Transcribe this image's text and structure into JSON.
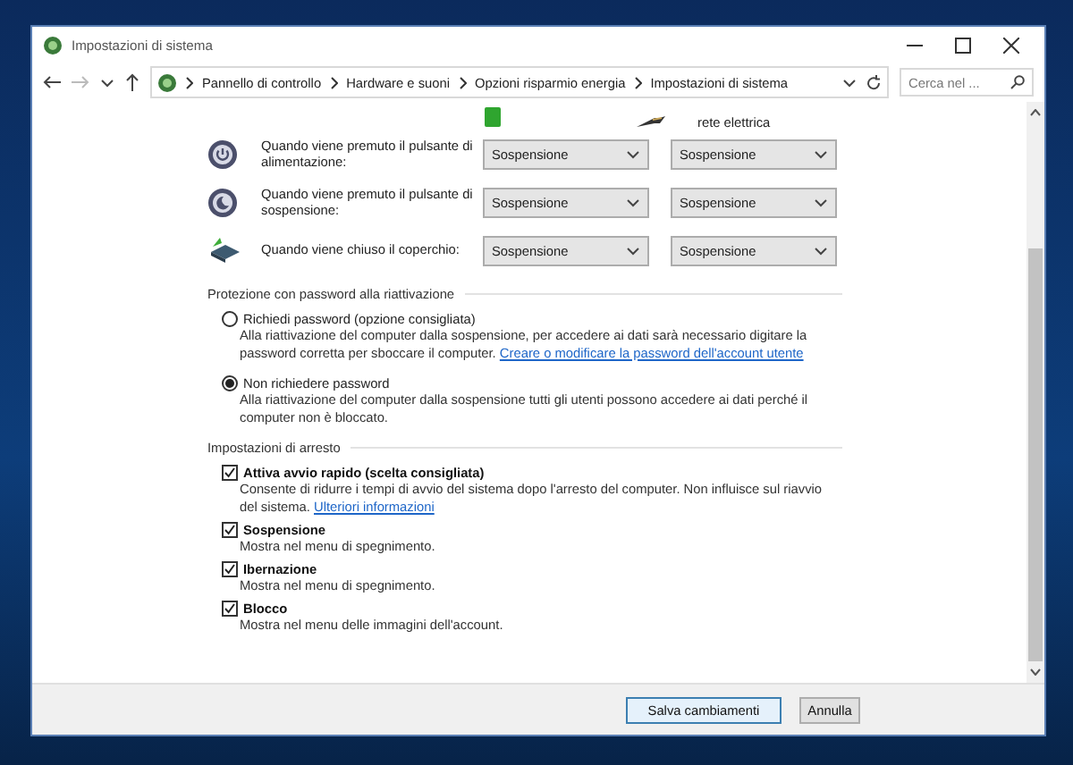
{
  "window": {
    "title": "Impostazioni di sistema"
  },
  "address_bar": {
    "path": [
      "Pannello di controllo",
      "Hardware e suoni",
      "Opzioni risparmio energia",
      "Impostazioni di sistema"
    ],
    "search_placeholder": "Cerca nel ..."
  },
  "power_settings": {
    "column_2_header": "rete elettrica",
    "rows": [
      {
        "kind": "power",
        "label": "Quando viene premuto il pulsante di alimentazione:",
        "on_battery": "Sospensione",
        "plugged_in": "Sospensione"
      },
      {
        "kind": "sleep",
        "label": "Quando viene premuto il pulsante di sospensione:",
        "on_battery": "Sospensione",
        "plugged_in": "Sospensione"
      },
      {
        "kind": "lid",
        "label": "Quando viene chiuso il coperchio:",
        "on_battery": "Sospensione",
        "plugged_in": "Sospensione"
      }
    ]
  },
  "password_section": {
    "title": "Protezione con password alla riattivazione",
    "options": [
      {
        "label": "Richiedi password (opzione consigliata)",
        "description": "Alla riattivazione del computer dalla sospensione, per accedere ai dati sarà necessario digitare la password corretta per sboccare il computer.",
        "link": "Creare o modificare la password dell'account utente",
        "selected": false
      },
      {
        "label": "Non richiedere password",
        "description": "Alla riattivazione del computer dalla sospensione tutti gli utenti possono accedere ai dati perché il computer non è bloccato.",
        "selected": true
      }
    ]
  },
  "shutdown_section": {
    "title": "Impostazioni di arresto",
    "options": [
      {
        "label": "Attiva avvio rapido (scelta consigliata)",
        "description": "Consente di ridurre i tempi di avvio del sistema dopo l'arresto del computer. Non influisce sul riavvio del sistema.",
        "link": "Ulteriori informazioni",
        "checked": true
      },
      {
        "label": "Sospensione",
        "description": "Mostra nel menu di spegnimento.",
        "checked": true
      },
      {
        "label": "Ibernazione",
        "description": "Mostra nel menu di spegnimento.",
        "checked": true
      },
      {
        "label": "Blocco",
        "description": "Mostra nel menu delle immagini dell'account.",
        "checked": true
      }
    ]
  },
  "buttons": [
    "Salva cambiamenti",
    "Annulla"
  ]
}
